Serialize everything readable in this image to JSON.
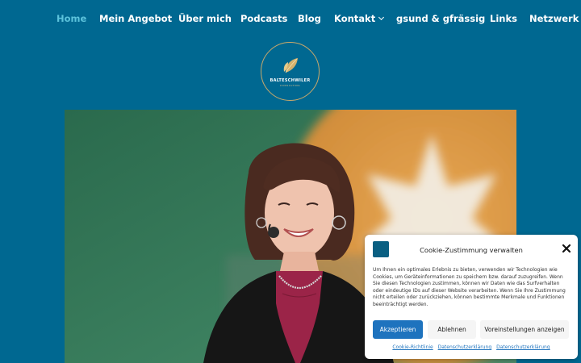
{
  "nav": {
    "items": [
      {
        "label": "Home",
        "active": true
      },
      {
        "label": "Mein Angebot"
      },
      {
        "label": "Über mich"
      },
      {
        "label": "Podcasts"
      },
      {
        "label": "Blog"
      },
      {
        "label": "Kontakt",
        "has_dropdown": true
      },
      {
        "label": "gsund & gfrässig"
      },
      {
        "label": "Links"
      },
      {
        "label": "Netzwerk"
      }
    ]
  },
  "logo": {
    "name": "BALTESCHWILER",
    "sub": "CONSULTING",
    "leaf_icon": "leaf-icon"
  },
  "hero": {
    "image": "Woman with short brown hair and headset microphone smiling on stage"
  },
  "cookie": {
    "title": "Cookie-Zustimmung verwalten",
    "text": "Um Ihnen ein optimales Erlebnis zu bieten, verwenden wir Technologien wie Cookies, um Geräteinformationen zu speichern bzw. darauf zuzugreifen. Wenn Sie diesen Technologien zustimmen, können wir Daten wie das Surfverhalten oder eindeutige IDs auf dieser Website verarbeiten. Wenn Sie Ihre Zustimmung nicht erteilen oder zurückziehen, können bestimmte Merkmale und Funktionen beeinträchtigt werden.",
    "accept_label": "Akzeptieren",
    "deny_label": "Ablehnen",
    "prefs_label": "Voreinstellungen anzeigen",
    "links": [
      "Cookie-Richtlinie",
      "Datenschutzerklärung",
      "Datenschutzerklärung"
    ]
  },
  "colors": {
    "background": "#006891",
    "nav_active": "#5cc3dc",
    "accent_button": "#1e73be",
    "logo_gold": "#c9a96a"
  }
}
